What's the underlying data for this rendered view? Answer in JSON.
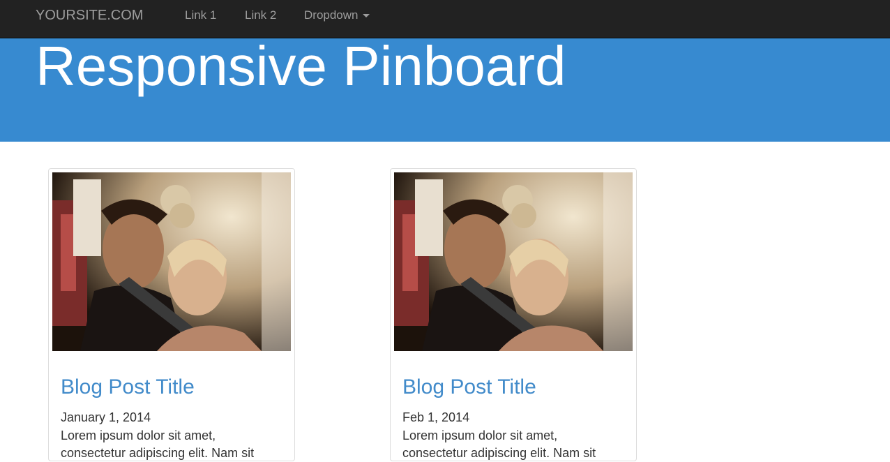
{
  "navbar": {
    "brand": "YOURSITE.COM",
    "links": [
      {
        "label": "Link 1"
      },
      {
        "label": "Link 2"
      },
      {
        "label": "Dropdown"
      }
    ]
  },
  "jumbotron": {
    "title": "Responsive Pinboard"
  },
  "posts": [
    {
      "title": "Blog Post Title",
      "date": "January 1, 2014",
      "excerpt": "Lorem ipsum dolor sit amet, consectetur adipiscing elit. Nam sit"
    },
    {
      "title": "Blog Post Title",
      "date": "Feb 1, 2014",
      "excerpt": "Lorem ipsum dolor sit amet, consectetur adipiscing elit. Nam sit"
    }
  ],
  "colors": {
    "navbar_bg": "#222222",
    "jumbotron_bg": "#378ad0",
    "link_blue": "#428bca"
  }
}
